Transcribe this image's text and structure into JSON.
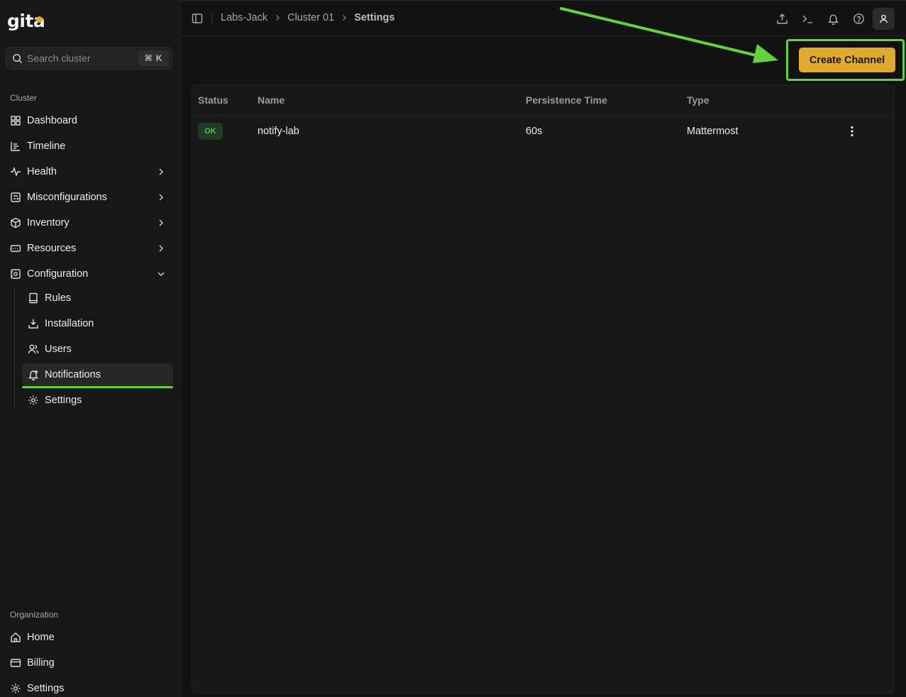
{
  "brand": {
    "name": "gita",
    "accent": "#e6a81e"
  },
  "search": {
    "placeholder": "Search cluster",
    "shortcut_symbol": "⌘",
    "shortcut_key": "K"
  },
  "sidebar": {
    "cluster_label": "Cluster",
    "items": [
      {
        "label": "Dashboard",
        "icon": "grid-icon"
      },
      {
        "label": "Timeline",
        "icon": "timeline-icon"
      },
      {
        "label": "Health",
        "icon": "activity-icon",
        "expandable": true
      },
      {
        "label": "Misconfigurations",
        "icon": "misconfig-icon",
        "expandable": true
      },
      {
        "label": "Inventory",
        "icon": "box-icon",
        "expandable": true
      },
      {
        "label": "Resources",
        "icon": "resources-icon",
        "expandable": true
      },
      {
        "label": "Configuration",
        "icon": "configuration-icon",
        "expanded": true
      }
    ],
    "config_children": [
      {
        "label": "Rules",
        "icon": "book-icon"
      },
      {
        "label": "Installation",
        "icon": "install-icon"
      },
      {
        "label": "Users",
        "icon": "users-icon"
      },
      {
        "label": "Notifications",
        "icon": "bell-icon",
        "active": true
      },
      {
        "label": "Settings",
        "icon": "gear-icon"
      }
    ],
    "org_label": "Organization",
    "org_items": [
      {
        "label": "Home",
        "icon": "home-icon"
      },
      {
        "label": "Billing",
        "icon": "card-icon"
      },
      {
        "label": "Settings",
        "icon": "gear-icon"
      }
    ]
  },
  "header": {
    "breadcrumb": [
      "Labs-Jack",
      "Cluster 01",
      "Settings"
    ]
  },
  "actions": {
    "create_label": "Create Channel"
  },
  "table": {
    "columns": [
      "Status",
      "Name",
      "Persistence Time",
      "Type"
    ],
    "rows": [
      {
        "status": "OK",
        "name": "notify-lab",
        "persistence": "60s",
        "type": "Mattermost"
      }
    ]
  },
  "colors": {
    "highlight": "#63d33c",
    "button": "#e1aa2c",
    "ok_badge": "#1f3b24"
  }
}
